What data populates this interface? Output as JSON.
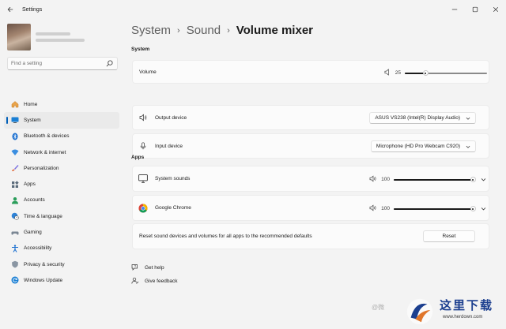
{
  "window": {
    "title": "Settings"
  },
  "search": {
    "placeholder": "Find a setting"
  },
  "sidebar": {
    "items": [
      {
        "label": "Home",
        "icon": "home-icon",
        "active": false
      },
      {
        "label": "System",
        "icon": "display-icon",
        "active": true
      },
      {
        "label": "Bluetooth & devices",
        "icon": "bluetooth-icon",
        "active": false
      },
      {
        "label": "Network & internet",
        "icon": "wifi-icon",
        "active": false
      },
      {
        "label": "Personalization",
        "icon": "brush-icon",
        "active": false
      },
      {
        "label": "Apps",
        "icon": "apps-icon",
        "active": false
      },
      {
        "label": "Accounts",
        "icon": "person-icon",
        "active": false
      },
      {
        "label": "Time & language",
        "icon": "globe-clock-icon",
        "active": false
      },
      {
        "label": "Gaming",
        "icon": "gamepad-icon",
        "active": false
      },
      {
        "label": "Accessibility",
        "icon": "accessibility-icon",
        "active": false
      },
      {
        "label": "Privacy & security",
        "icon": "shield-icon",
        "active": false
      },
      {
        "label": "Windows Update",
        "icon": "update-icon",
        "active": false
      }
    ]
  },
  "breadcrumb": {
    "items": [
      "System",
      "Sound",
      "Volume mixer"
    ],
    "separator": "›"
  },
  "system_section": {
    "label": "System",
    "volume": {
      "label": "Volume",
      "value": "25",
      "level": 25
    },
    "output": {
      "label": "Output device",
      "value": "ASUS VS238 (Intel(R) Display Audio)"
    },
    "input": {
      "label": "Input device",
      "value": "Microphone (HD Pro Webcam C920)"
    }
  },
  "apps_section": {
    "label": "Apps",
    "apps": [
      {
        "label": "System sounds",
        "icon": "monitor-icon",
        "value": "100",
        "level": 100
      },
      {
        "label": "Google Chrome",
        "icon": "chrome-icon",
        "value": "100",
        "level": 100
      }
    ],
    "reset_text": "Reset sound devices and volumes for all apps to the recommended defaults",
    "reset_button": "Reset"
  },
  "help": {
    "get_help": "Get help",
    "give_feedback": "Give feedback"
  },
  "watermark": {
    "small": "@微",
    "cn": "这里下载",
    "url": "www.herdown.com"
  },
  "colors": {
    "accent": "#005fb8",
    "background": "#f3f3f3",
    "card": "#fbfbfb"
  }
}
